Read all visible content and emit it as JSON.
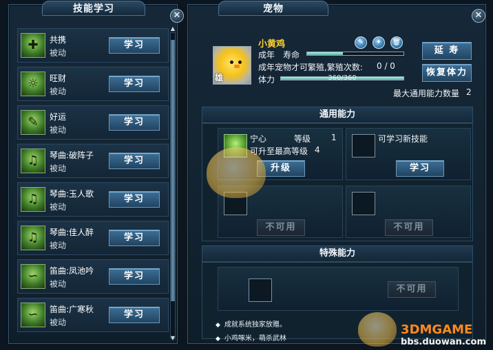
{
  "skill_panel": {
    "title": "技能学习",
    "close_label": "✕",
    "skills": [
      {
        "name": "共携",
        "type": "被动",
        "button": "学习",
        "icon": "bag-plus-icon",
        "glyph": "✚"
      },
      {
        "name": "旺财",
        "type": "被动",
        "button": "学习",
        "icon": "sun-money-icon",
        "glyph": "☼"
      },
      {
        "name": "好运",
        "type": "被动",
        "button": "学习",
        "icon": "lucky-card-icon",
        "glyph": "✎"
      },
      {
        "name": "琴曲:破阵子",
        "type": "被动",
        "button": "学习",
        "icon": "guqin-icon",
        "glyph": "♫"
      },
      {
        "name": "琴曲:玉人歌",
        "type": "被动",
        "button": "学习",
        "icon": "guqin-icon",
        "glyph": "♫"
      },
      {
        "name": "琴曲:佳人醉",
        "type": "被动",
        "button": "学习",
        "icon": "guqin-icon",
        "glyph": "♫"
      },
      {
        "name": "笛曲:凤池吟",
        "type": "被动",
        "button": "学习",
        "icon": "flute-icon",
        "glyph": "∽"
      },
      {
        "name": "笛曲:广寒秋",
        "type": "被动",
        "button": "学习",
        "icon": "flute-icon",
        "glyph": "∽"
      }
    ]
  },
  "pet_panel": {
    "title": "宠物",
    "close_label": "✕",
    "pet": {
      "name": "小黄鸡",
      "gender": "雄",
      "stage": "成年",
      "lifespan_label": "寿命",
      "lifespan_fraction": 0.37,
      "breed_text": "成年宠物才可繁殖,繁殖次数:",
      "breed_count": "0 / 0",
      "stamina_label": "体力",
      "stamina_text": "360/360",
      "stamina_fraction": 1.0
    },
    "tools": [
      {
        "icon": "brush-icon",
        "glyph": "✎"
      },
      {
        "icon": "feather-icon",
        "glyph": "✦"
      },
      {
        "icon": "trash-icon",
        "glyph": "🗑"
      }
    ],
    "extend_life_button": "延 寿",
    "restore_stamina_button": "恢复体力",
    "max_general_label": "最大通用能力数量",
    "max_general_value": "2",
    "general_section": {
      "title": "通用能力",
      "skill_name": "宁心",
      "level_label": "等级",
      "level_value": "1",
      "max_level_label": "可升至最高等级",
      "max_level_value": "4",
      "upgrade_button": "升级",
      "learn_new_label": "可学习新技能",
      "learn_button": "学习",
      "unavailable_button_1": "不可用",
      "unavailable_button_2": "不可用"
    },
    "special_section": {
      "title": "特殊能力",
      "unavailable_button": "不可用"
    },
    "notes": [
      "成就系统独家放赠。",
      "小鸡啄米，萌杀武林"
    ]
  },
  "watermark": {
    "logo": "3DMGAME",
    "site": "bbs.duowan.com"
  },
  "colors": {
    "pet_name": "#ffd22a",
    "button": "#2f5a7d",
    "panel_bg": "#122333"
  }
}
